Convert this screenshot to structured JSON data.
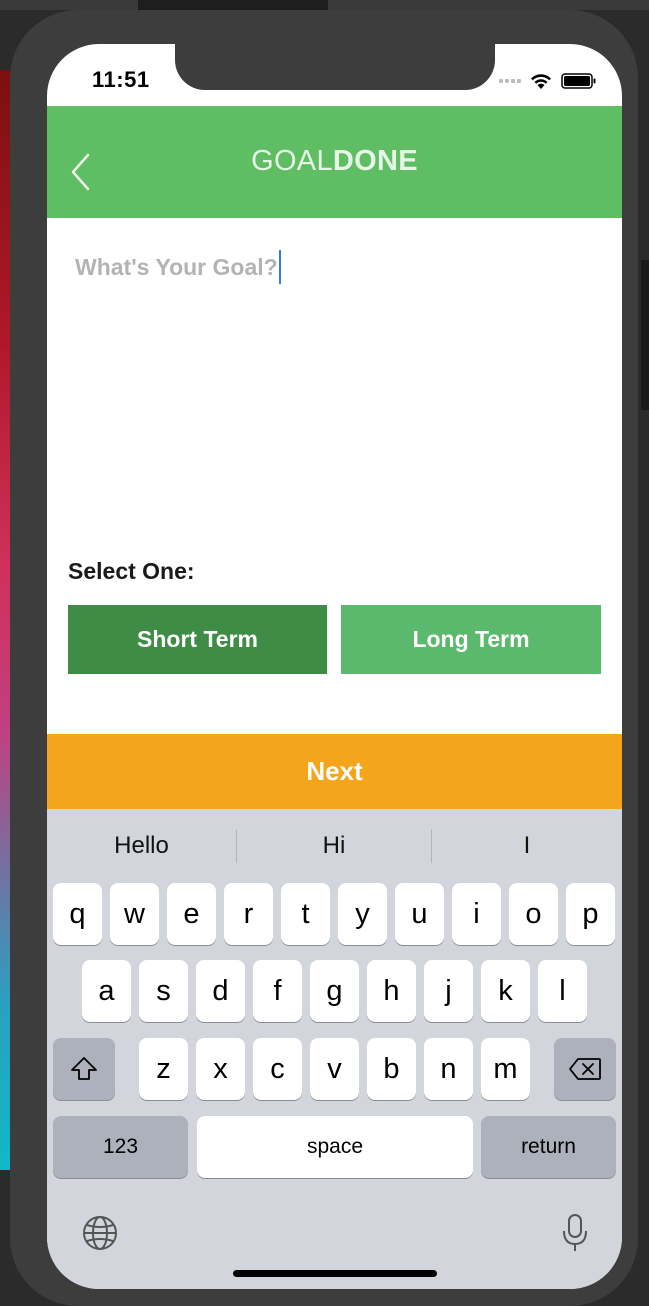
{
  "status_bar": {
    "time": "11:51",
    "wifi_icon": "wifi-icon",
    "battery_icon": "battery-icon"
  },
  "header": {
    "logo_light": "GOAL",
    "logo_bold": "DONE",
    "back_icon": "chevron-left-icon"
  },
  "goal": {
    "placeholder": "What's Your Goal?",
    "value": ""
  },
  "term_selection": {
    "label": "Select One:",
    "short_term": "Short Term",
    "long_term": "Long Term"
  },
  "next_button": "Next",
  "colors": {
    "header_green": "#5fbd64",
    "short_term_green": "#3f8c46",
    "long_term_green": "#5ab96d",
    "next_orange": "#f5a51c",
    "caret_blue": "#2f7fdc"
  },
  "keyboard": {
    "suggestions": [
      "Hello",
      "Hi",
      "I"
    ],
    "row1": [
      "q",
      "w",
      "e",
      "r",
      "t",
      "y",
      "u",
      "i",
      "o",
      "p"
    ],
    "row2": [
      "a",
      "s",
      "d",
      "f",
      "g",
      "h",
      "j",
      "k",
      "l"
    ],
    "row3": [
      "z",
      "x",
      "c",
      "v",
      "b",
      "n",
      "m"
    ],
    "numbers_key": "123",
    "space_key": "space",
    "return_key": "return",
    "shift_icon": "shift-icon",
    "delete_icon": "delete-icon",
    "globe_icon": "globe-icon",
    "mic_icon": "microphone-icon"
  }
}
